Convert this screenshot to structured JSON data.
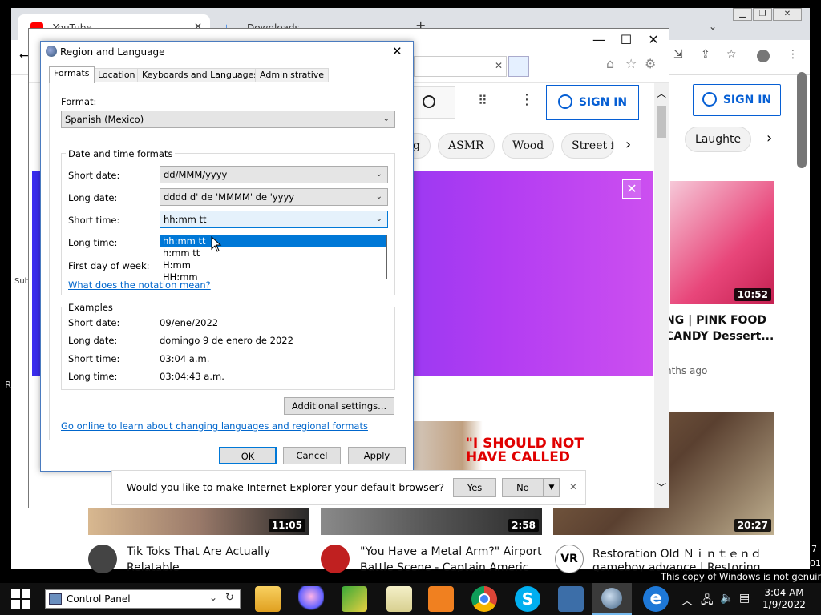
{
  "chrome": {
    "tabs": [
      {
        "label": "YouTube"
      },
      {
        "label": "Downloads"
      }
    ]
  },
  "ie": {
    "sign_in_label": "SIGN IN",
    "chips": [
      "g",
      "ASMR",
      "Wood",
      "Street fo"
    ],
    "right_panel": {
      "sign_in_label": "SIGN IN",
      "chip": "Laughte",
      "video1": {
        "duration": "10:52",
        "title1": "NG | PINK FOOD",
        "title2": "CANDY Dessert...",
        "meta": "nths ago"
      },
      "video2": {
        "duration": "20:27"
      }
    },
    "thumb_text": "\"I SHOULD NOT HAVE CALLED",
    "left_edge_text": "Sub",
    "left_edge_text2": "R"
  },
  "dialog": {
    "title": "Region and Language",
    "tabs": [
      "Formats",
      "Location",
      "Keyboards and Languages",
      "Administrative"
    ],
    "format_label": "Format:",
    "format_value": "Spanish (Mexico)",
    "datetime_group": "Date and time formats",
    "short_date_label": "Short date:",
    "short_date_value": "dd/MMM/yyyy",
    "long_date_label": "Long date:",
    "long_date_value": "dddd d' de 'MMMM' de 'yyyy",
    "short_time_label": "Short time:",
    "short_time_value": "hh:mm tt",
    "long_time_label": "Long time:",
    "first_day_label": "First day of week:",
    "notation_link": "What does the notation mean?",
    "dropdown_options": [
      "hh:mm tt",
      "h:mm tt",
      "H:mm",
      "HH:mm"
    ],
    "examples_group": "Examples",
    "ex_short_date_label": "Short date:",
    "ex_short_date": "09/ene/2022",
    "ex_long_date_label": "Long date:",
    "ex_long_date": "domingo 9 de enero de 2022",
    "ex_short_time_label": "Short time:",
    "ex_short_time": "03:04 a.m.",
    "ex_long_time_label": "Long time:",
    "ex_long_time": "03:04:43 a.m.",
    "additional_settings": "Additional settings...",
    "online_link": "Go online to learn about changing languages and regional formats",
    "ok": "OK",
    "cancel": "Cancel",
    "apply": "Apply"
  },
  "notification": {
    "text": "Would you like to make Internet Explorer your default browser?",
    "yes": "Yes",
    "no": "No"
  },
  "videos": [
    {
      "duration": "11:05",
      "title": "Tik Toks That Are Actually",
      "title2": "Relatable"
    },
    {
      "duration": "2:58",
      "title": "\"You Have a Metal Arm?\" Airport",
      "title2": "Battle Scene - Captain Americ"
    },
    {
      "title": "Restoration Old Ｎｉｎｔｅｎｄｏ",
      "title2": "gameboy advance | Restoring"
    }
  ],
  "watermark": "This copy of Windows is not genuine",
  "watermark_side": "7",
  "watermark_side2": "01",
  "taskbar": {
    "search_text": "Control Panel",
    "time": "3:04 AM",
    "date": "1/9/2022"
  },
  "colors": {
    "accent": "#0078d7",
    "link": "#0066cc",
    "youtube_blue": "#065fd4"
  }
}
